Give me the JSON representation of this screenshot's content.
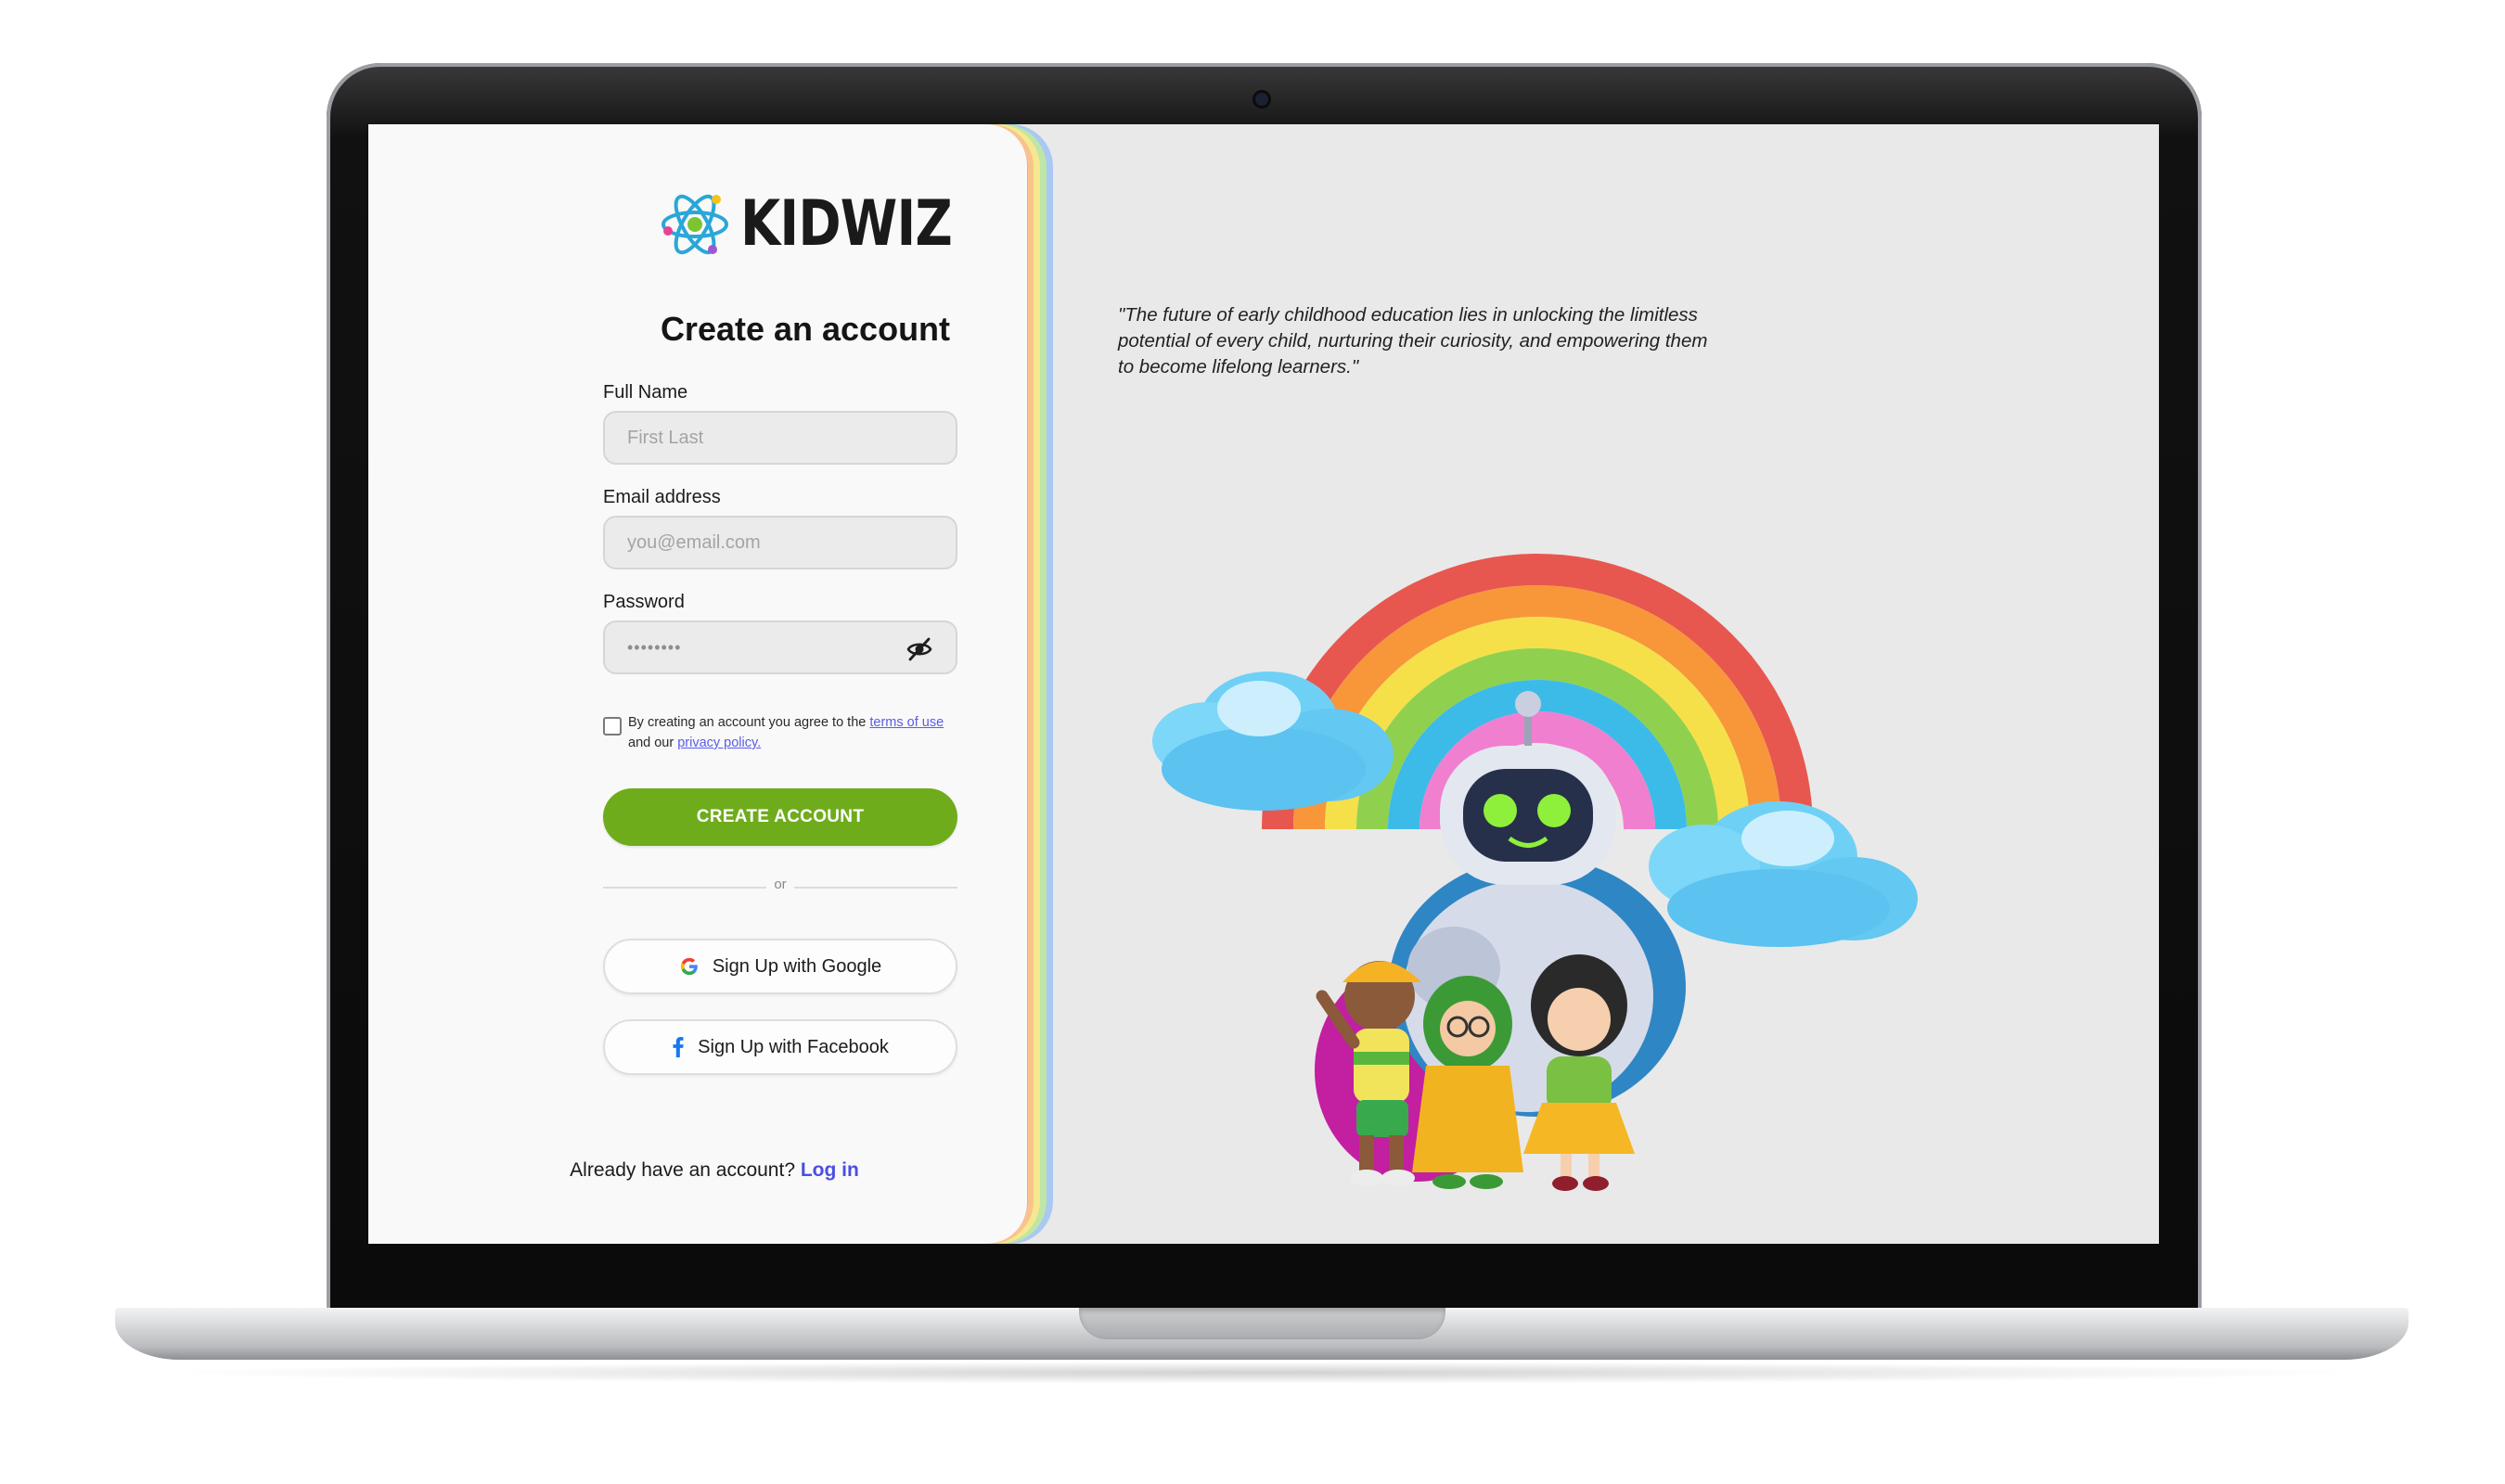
{
  "brand": {
    "name": "KIDWIZ"
  },
  "signup": {
    "title": "Create an account",
    "full_name": {
      "label": "Full Name",
      "placeholder": "First Last"
    },
    "email": {
      "label": "Email address",
      "placeholder": "you@email.com"
    },
    "password": {
      "label": "Password",
      "value": "••••••••"
    },
    "agree": {
      "text_before": "By creating an account you agree to the ",
      "terms_link": "terms of use",
      "text_middle": " and our ",
      "privacy_link": "privacy policy."
    },
    "create_button": "CREATE ACCOUNT",
    "divider_text": "or",
    "google_button": "Sign Up with Google",
    "facebook_button": "Sign Up with Facebook",
    "login_prompt": "Already have an account? ",
    "login_link": "Log in"
  },
  "hero": {
    "quote": "\"The future of early childhood education lies in unlocking the limitless potential of every child, nurturing their curiosity, and empowering them to become lifelong learners.\""
  },
  "colors": {
    "primary_button": "#6fac1b",
    "link": "#4b4ee0"
  }
}
